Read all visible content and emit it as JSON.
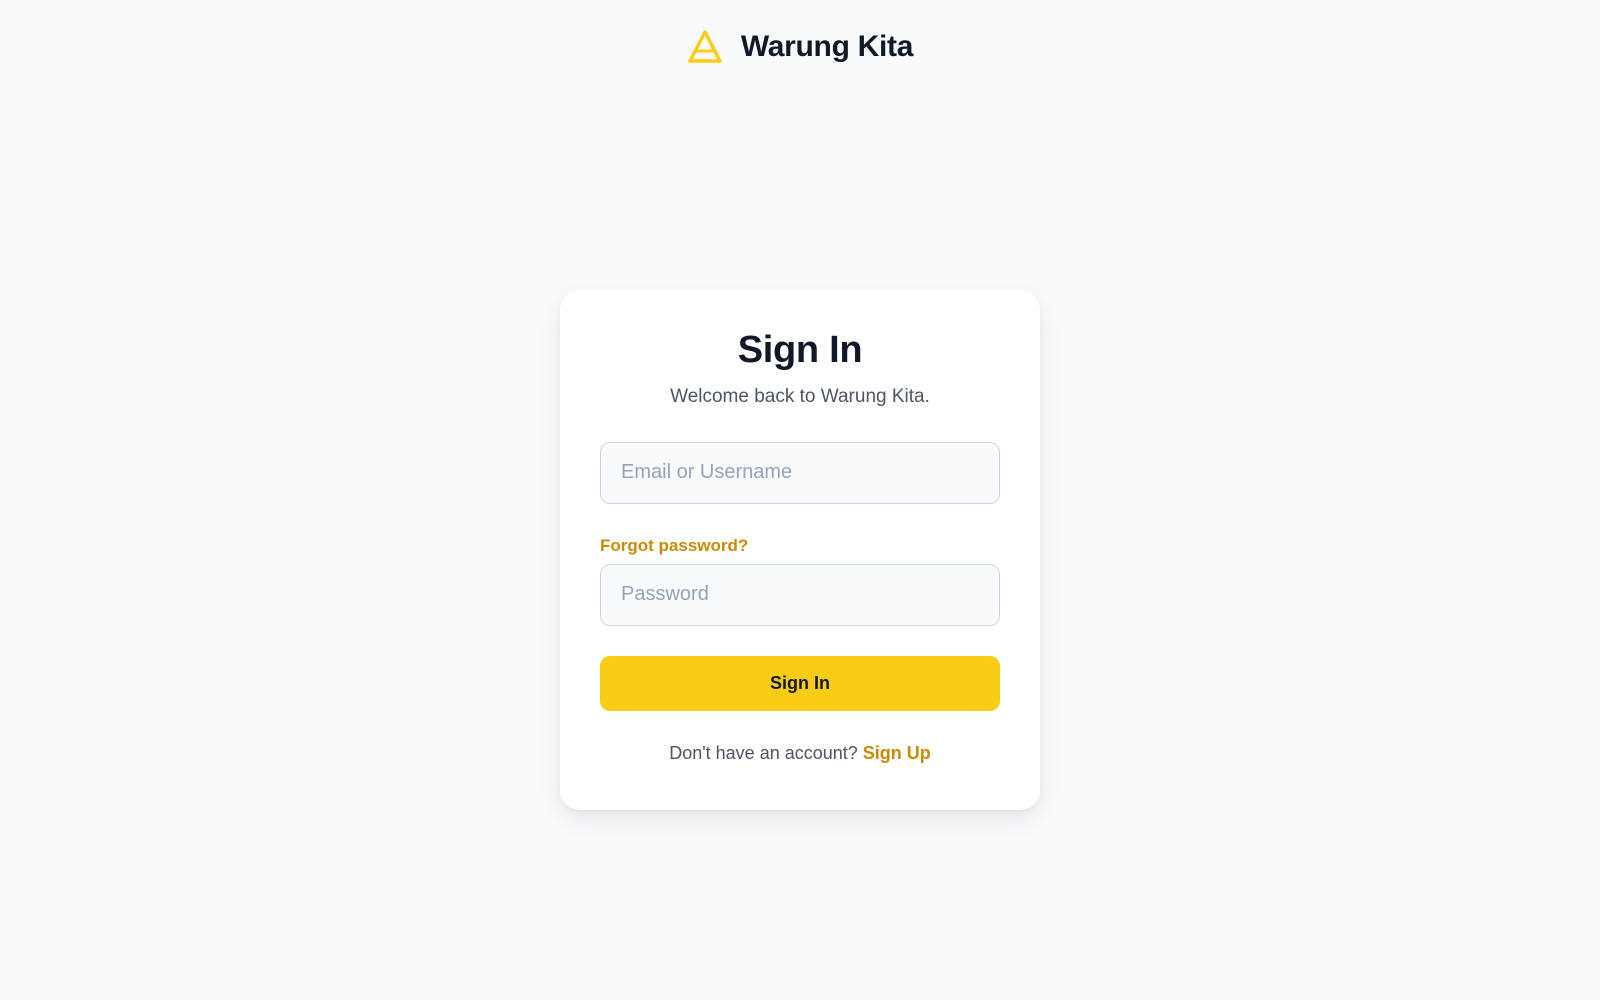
{
  "brand": {
    "name": "Warung Kita",
    "icon": "triangle-logo-icon",
    "accent_color": "#facc15"
  },
  "card": {
    "title": "Sign In",
    "subtitle": "Welcome back to Warung Kita."
  },
  "form": {
    "email_placeholder": "Email or Username",
    "email_value": "",
    "forgot_label": "Forgot password?",
    "password_placeholder": "Password",
    "password_value": "",
    "submit_label": "Sign In"
  },
  "signup": {
    "prompt": "Don't have an account?",
    "link_label": "Sign Up"
  },
  "colors": {
    "background": "#f8fafc",
    "link": "#ca8a04",
    "button": "#facc15",
    "text_dark": "#111827",
    "text_muted": "#4b5563"
  }
}
